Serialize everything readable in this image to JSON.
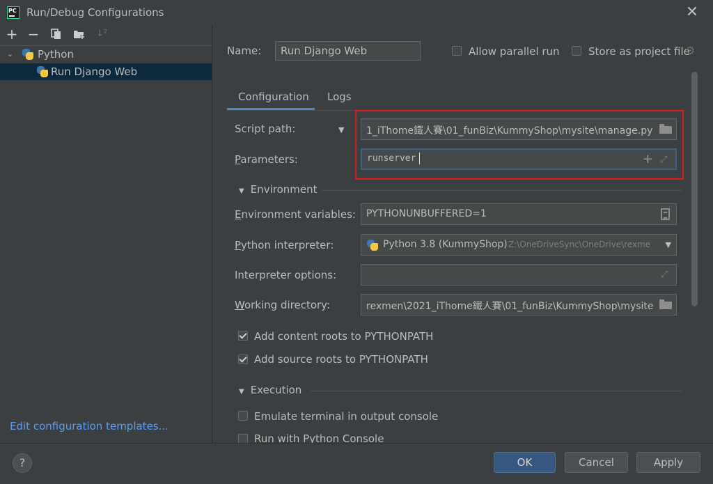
{
  "window": {
    "title": "Run/Debug Configurations",
    "app_icon_text": "PC"
  },
  "toolbar": {
    "icons": [
      "add-icon",
      "remove-icon",
      "copy-icon",
      "folder-add-icon",
      "sort-icon"
    ],
    "add_glyph": "+",
    "remove_glyph": "−",
    "sort_glyph": "↓²"
  },
  "tree": {
    "group_label": "Python",
    "item_label": "Run Django Web"
  },
  "left_footer": {
    "edit_templates_link": "Edit configuration templates..."
  },
  "header": {
    "name_label": "Name:",
    "name_value": "Run Django Web",
    "allow_parallel_label": "Allow parallel run",
    "store_project_label": "Store as project file"
  },
  "tabs": {
    "configuration": "Configuration",
    "logs": "Logs"
  },
  "config": {
    "script_path_label": "Script path:",
    "script_path_value": "1_iThome鐵人賽\\01_funBiz\\KummyShop\\mysite\\manage.py",
    "parameters_label": "Parameters:",
    "parameters_value": "runserver",
    "environment_section": "Environment",
    "env_vars_label": "Environment variables:",
    "env_vars_value": "PYTHONUNBUFFERED=1",
    "interpreter_label": "Python interpreter:",
    "interpreter_name": "Python 3.8 (KummyShop)",
    "interpreter_path": "Z:\\OneDriveSync\\OneDrive\\rexme",
    "interp_options_label": "Interpreter options:",
    "interp_options_value": "",
    "working_dir_label": "Working directory:",
    "working_dir_value": "rexmen\\2021_iThome鐵人賽\\01_funBiz\\KummyShop\\mysite",
    "add_content_roots_label": "Add content roots to PYTHONPATH",
    "add_source_roots_label": "Add source roots to PYTHONPATH",
    "execution_section": "Execution",
    "emulate_terminal_label": "Emulate terminal in output console",
    "run_python_console_label": "Run with Python Console"
  },
  "buttons": {
    "help": "?",
    "ok": "OK",
    "cancel": "Cancel",
    "apply": "Apply"
  },
  "colors": {
    "accent": "#4a88c7",
    "highlight_box": "#e01b24",
    "link": "#589df6",
    "ok_button": "#365880"
  }
}
